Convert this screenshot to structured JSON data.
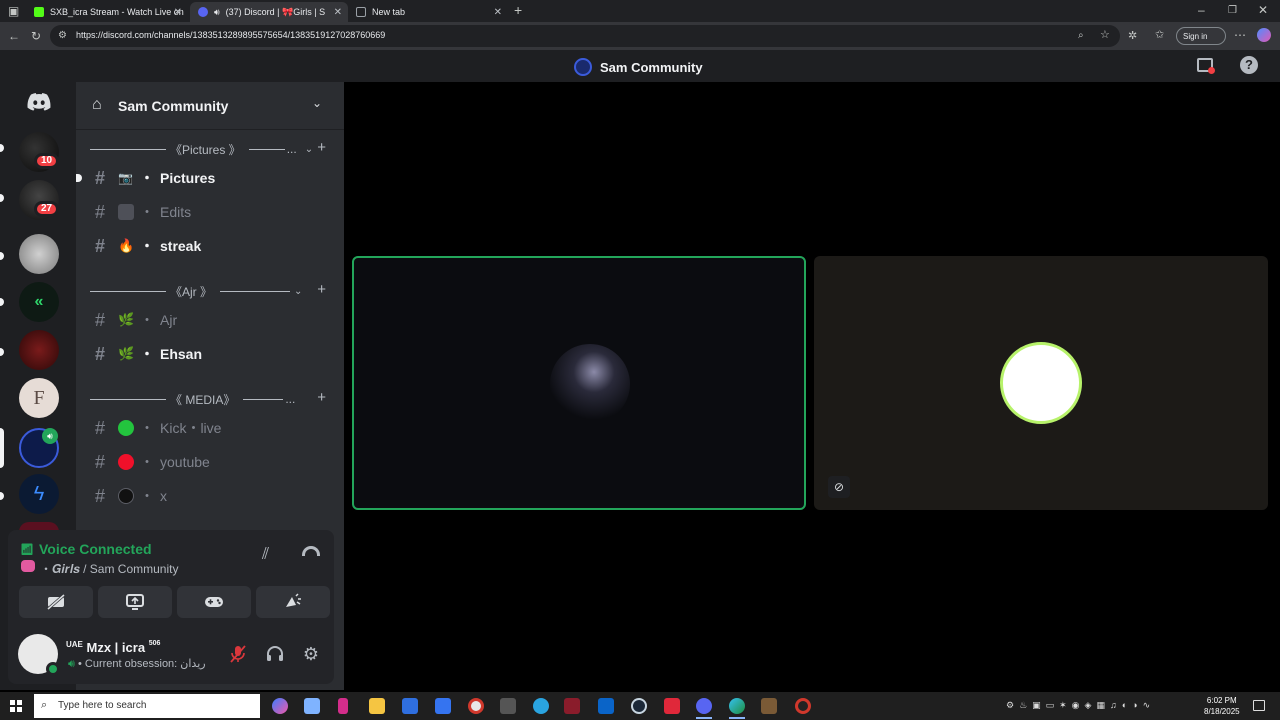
{
  "browser": {
    "tabs": [
      {
        "title": "SXB_icra Stream - Watch Live on",
        "favicon_color": "#53fc18"
      },
      {
        "title": "(37) Discord | 🎀Girls | S",
        "favicon_color": "#5865f2"
      },
      {
        "title": "New tab",
        "favicon_color": "#9aa0a6"
      }
    ],
    "url": "https://discord.com/channels/1383513289895575654/1383519127028760669",
    "sign_in_label": "Sign in"
  },
  "titlebar": {
    "server_name": "Sam Community"
  },
  "rail": {
    "badges": [
      "10",
      "27"
    ]
  },
  "sidebar": {
    "server_name": "Sam Community",
    "categories": [
      {
        "label": "《Pictures 》"
      },
      {
        "label": "《Ajr 》"
      },
      {
        "label": "《 MEDIA》"
      }
    ],
    "channels": [
      {
        "label": "Pictures",
        "emoji": "📷"
      },
      {
        "label": "Edits",
        "emoji": "🎞"
      },
      {
        "label": "streak",
        "emoji": "🔥"
      },
      {
        "label": "Ajr",
        "emoji": "🌿"
      },
      {
        "label": "Ehsan",
        "emoji": "🌿"
      },
      {
        "label": "Kick・live",
        "emoji": "🟢"
      },
      {
        "label": "youtube",
        "emoji": "🔴"
      },
      {
        "label": "x",
        "emoji": "⚫"
      }
    ]
  },
  "voice": {
    "status": "Voice Connected",
    "channel_path": "𝑮𝒊𝒓𝒍𝒔 / Sam Community"
  },
  "user": {
    "name": "Mzx | icra",
    "name_prefix": "UAE",
    "name_suffix": "506",
    "status": "Current obsession: ريدان"
  },
  "taskbar": {
    "search_placeholder": "Type here to search",
    "time": "6:02 PM",
    "date": "8/18/2025"
  },
  "colors": {
    "speaking_ring": "#23a55a",
    "discord_blurple": "#5865f2",
    "mention_red": "#f23f43"
  }
}
